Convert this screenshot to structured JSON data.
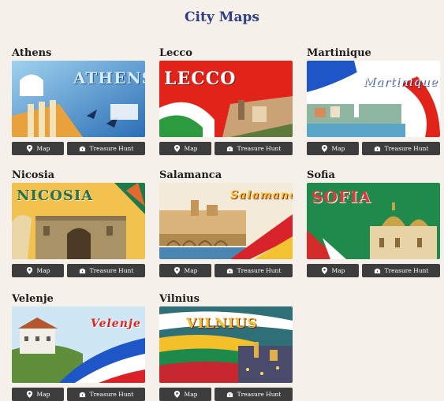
{
  "page": {
    "title": "City Maps"
  },
  "buttons": {
    "map_label": "Map",
    "hunt_label": "Treasure Hunt",
    "map_icon": "map-pin-icon",
    "hunt_icon": "treasure-chest-icon"
  },
  "cities": [
    {
      "name": "Athens",
      "artwork_text": "ATHENS",
      "theme": "blue"
    },
    {
      "name": "Lecco",
      "artwork_text": "LECCO",
      "theme": "red-green"
    },
    {
      "name": "Martinique",
      "artwork_text": "Martinique",
      "theme": "blue-red"
    },
    {
      "name": "Nicosia",
      "artwork_text": "NICOSIA",
      "theme": "yellow-stone"
    },
    {
      "name": "Salamanca",
      "artwork_text": "Salamanca",
      "theme": "red-yellow"
    },
    {
      "name": "Sofia",
      "artwork_text": "SOFIA",
      "theme": "green"
    },
    {
      "name": "Velenje",
      "artwork_text": "Velenje",
      "theme": "blue-white-red"
    },
    {
      "name": "Vilnius",
      "artwork_text": "VILNIUS",
      "theme": "yellow-green-red"
    }
  ],
  "colors": {
    "title": "#2f3f86",
    "button_bg": "#3d3d3d",
    "page_bg": "#f5f1ea"
  }
}
